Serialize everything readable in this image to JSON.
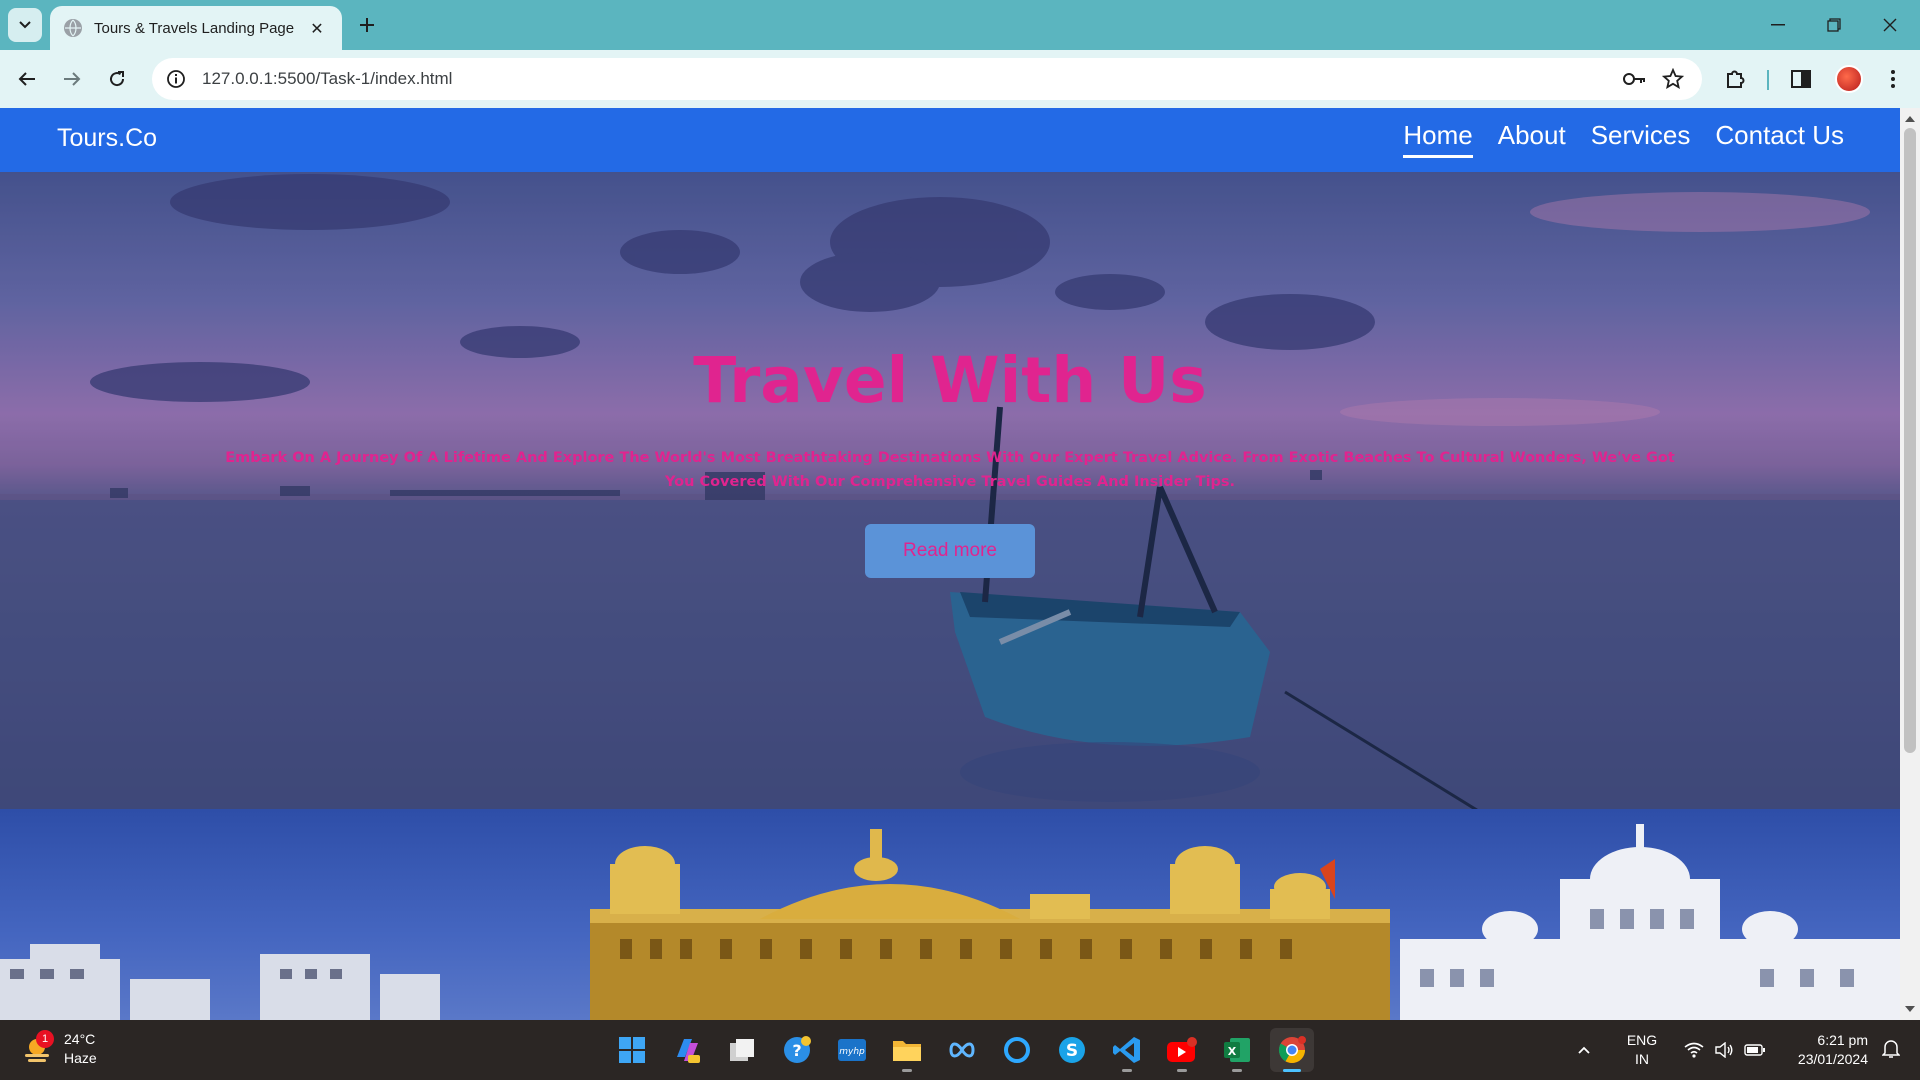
{
  "browser": {
    "tab_title": "Tours & Travels Landing Page",
    "url": "127.0.0.1:5500/Task-1/index.html"
  },
  "site": {
    "brand": "Tours.Co",
    "nav": [
      {
        "label": "Home",
        "active": true
      },
      {
        "label": "About",
        "active": false
      },
      {
        "label": "Services",
        "active": false
      },
      {
        "label": "Contact Us",
        "active": false
      }
    ]
  },
  "hero": {
    "title": "Travel With Us",
    "subtitle": "Embark On A Journey Of A Lifetime And Explore The World's Most Breathtaking Destinations With Our Expert Travel Advice. From Exotic Beaches To Cultural Wonders, We've Got You Covered With Our Comprehensive Travel Guides And Insider Tips.",
    "button_label": "Read more"
  },
  "colors": {
    "navbar": "#236ae6",
    "accent_text": "#e0248f",
    "button_bg": "#5b93d8",
    "chrome_tabstrip": "#5bb5bf"
  },
  "taskbar": {
    "weather_temp": "24°C",
    "weather_desc": "Haze",
    "weather_badge": "1",
    "lang_top": "ENG",
    "lang_bottom": "IN",
    "time": "6:21 pm",
    "date": "23/01/2024",
    "apps": [
      "windows-start-icon",
      "copilot-icon",
      "task-view-icon",
      "help-icon",
      "myhp-icon",
      "file-explorer-icon",
      "meta-icon",
      "cortana-icon",
      "skype-icon",
      "vscode-icon",
      "youtube-icon",
      "excel-icon",
      "chrome-icon"
    ]
  }
}
